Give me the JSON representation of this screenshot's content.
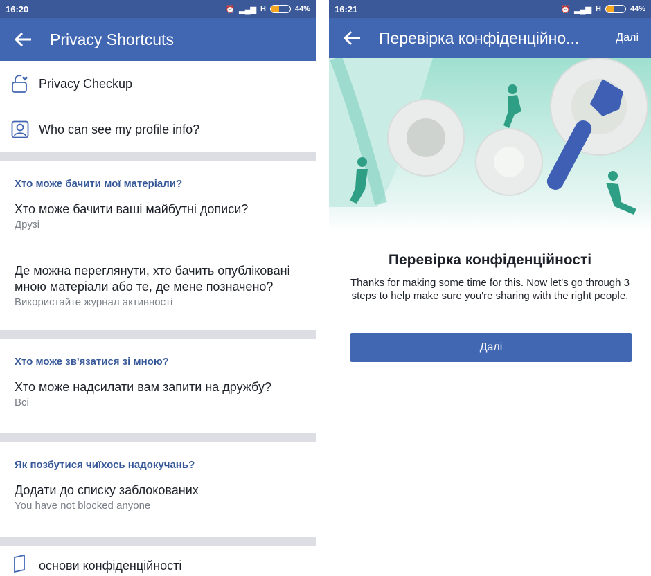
{
  "left": {
    "status": {
      "time": "16:20",
      "network": "H",
      "battery_text": "44%",
      "battery_level": 0.44
    },
    "appbar": {
      "title": "Privacy Shortcuts"
    },
    "shortcuts": [
      {
        "label": "Privacy Checkup",
        "icon": "lock-heart-icon"
      },
      {
        "label": "Who can see my profile info?",
        "icon": "profile-icon"
      }
    ],
    "sections": [
      {
        "heading": "Хто може бачити мої матеріали?",
        "items": [
          {
            "main": "Хто може бачити ваші майбутні дописи?",
            "sub": "Друзі"
          },
          {
            "main": "Де можна переглянути, хто бачить опубліковані мною матеріали або те, де мене позначено?",
            "sub": "Використайте журнал активності"
          }
        ]
      },
      {
        "heading": "Хто може зв'язатися зі мною?",
        "items": [
          {
            "main": "Хто може надсилати вам запити на дружбу?",
            "sub": "Всі"
          }
        ]
      },
      {
        "heading": "Як позбутися чиїхось надокучань?",
        "items": [
          {
            "main": "Додати до списку заблокованих",
            "sub": "You have not blocked anyone"
          }
        ]
      }
    ],
    "bottom_item": {
      "label": "основи конфіденційності",
      "icon": "book-icon"
    }
  },
  "right": {
    "status": {
      "time": "16:21",
      "network": "H",
      "battery_text": "44%",
      "battery_level": 0.44
    },
    "appbar": {
      "title": "Перевірка конфіденційно...",
      "next": "Далі"
    },
    "heading": "Перевірка конфіденційності",
    "description": "Thanks for making some time for this. Now let's go through 3 steps to help make sure you're sharing with the right people.",
    "button": "Далі"
  },
  "colors": {
    "brand": "#4267b2",
    "statusbar": "#3b5898",
    "section_heading": "#365899",
    "divider": "#dcdee3",
    "teal": "#2e9e85"
  }
}
